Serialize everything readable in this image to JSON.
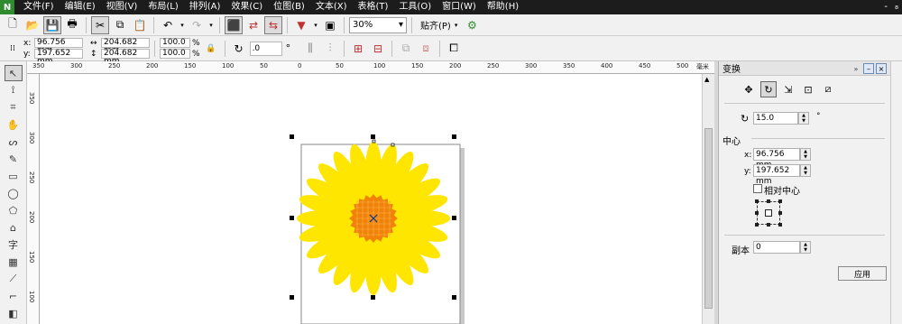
{
  "app": {
    "logo_glyph": "N"
  },
  "menu": {
    "items": [
      "文件(F)",
      "编辑(E)",
      "视图(V)",
      "布局(L)",
      "排列(A)",
      "效果(C)",
      "位图(B)",
      "文本(X)",
      "表格(T)",
      "工具(O)",
      "窗口(W)",
      "帮助(H)"
    ],
    "window_controls": [
      "-",
      "₈"
    ]
  },
  "toolbar": {
    "zoom": "30%",
    "snap_label": "贴齐(P)"
  },
  "propbar": {
    "x": "96.756 mm",
    "y": "197.652 mm",
    "width": "204.682 mm",
    "height": "204.682 mm",
    "scale_x": "100.0",
    "scale_y": "100.0",
    "percent": "%",
    "rotation": ".0",
    "degree": "°"
  },
  "ruler": {
    "top_labels": [
      "350",
      "300",
      "250",
      "200",
      "150",
      "100",
      "50",
      "0",
      "50",
      "100",
      "150",
      "200",
      "250",
      "300",
      "350",
      "400",
      "450",
      "500"
    ],
    "left_labels": [
      "350",
      "300",
      "250",
      "200",
      "150",
      "100"
    ],
    "unit": "毫米"
  },
  "docker": {
    "title": "变换",
    "rotation_value": "15.0",
    "degree": "°",
    "center_label": "中心",
    "x_label": "x:",
    "x_value": "96.756 mm",
    "y_label": "y:",
    "y_value": "197.652 mm",
    "relative_center_label": "相对中心",
    "copies_label": "副本",
    "copies_value": "0",
    "apply_label": "应用"
  },
  "colors": {
    "petal": "#ffe600",
    "center": "#f0820a",
    "accent_select": "#0a3a8a"
  }
}
